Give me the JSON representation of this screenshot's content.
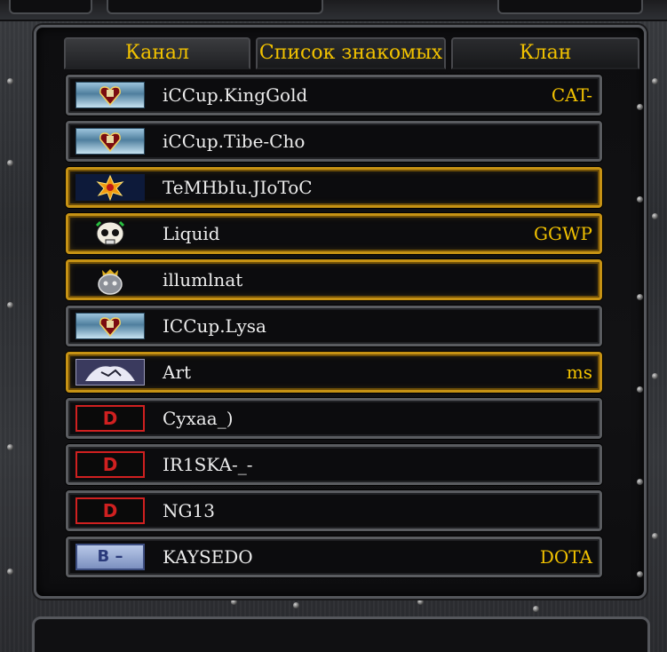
{
  "tabs": [
    {
      "label": "Канал",
      "active": true
    },
    {
      "label": "Список знакомых",
      "active": false
    },
    {
      "label": "Клан",
      "active": false
    }
  ],
  "players": [
    {
      "name": "iCCup.KingGold",
      "clan": "CAT-",
      "icon": "heart-shield-banner-icon",
      "highlight": false
    },
    {
      "name": "iCCup.Tibe-Cho",
      "clan": "",
      "icon": "heart-shield-banner-icon",
      "highlight": false
    },
    {
      "name": "TeMHbIu.JIoToC",
      "clan": "",
      "icon": "burst-star-icon",
      "highlight": true
    },
    {
      "name": "Liquid",
      "clan": "GGWP",
      "icon": "skull-icon",
      "highlight": true
    },
    {
      "name": "illumlnat",
      "clan": "",
      "icon": "mech-head-icon",
      "highlight": true
    },
    {
      "name": "ICCup.Lysa",
      "clan": "",
      "icon": "heart-shield-banner-icon",
      "highlight": false
    },
    {
      "name": "Art",
      "clan": "ms",
      "icon": "portrait-art-icon",
      "highlight": true
    },
    {
      "name": "Cyxaa_)",
      "clan": "",
      "icon": "rank-d-icon",
      "highlight": false
    },
    {
      "name": "IR1SKA-_-",
      "clan": "",
      "icon": "rank-d-icon",
      "highlight": false
    },
    {
      "name": "NG13",
      "clan": "",
      "icon": "rank-d-icon",
      "highlight": false
    },
    {
      "name": "KAYSEDO",
      "clan": "DOTA",
      "icon": "rank-b-minus-icon",
      "highlight": false
    }
  ],
  "rank_badges": {
    "d": "D",
    "b_minus": "B –"
  },
  "colors": {
    "accent_gold": "#f2c200",
    "text_white": "#ececec",
    "row_border": "#5a5c60",
    "row_highlight_border": "#c69214",
    "rank_d": "#d02020"
  }
}
